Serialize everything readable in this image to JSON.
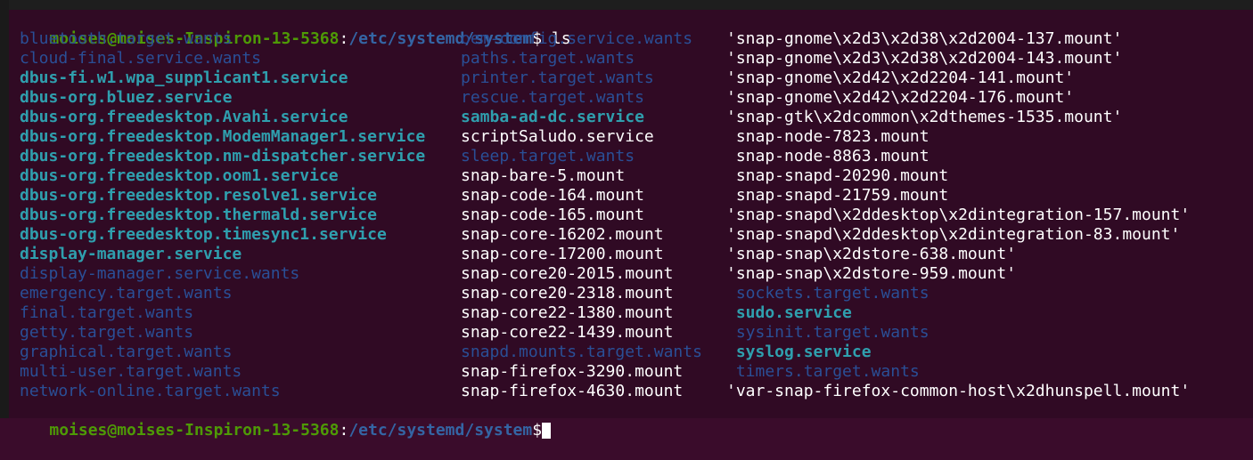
{
  "prompt": {
    "user_host": "moises@moises-Inspiron-13-5368",
    "sep": ":",
    "path": "/etc/systemd/system",
    "symbol": "$",
    "command": " ls"
  },
  "columns": [
    [
      {
        "text": "bluetooth.target.wants",
        "kind": "dir"
      },
      {
        "text": "cloud-final.service.wants",
        "kind": "dir"
      },
      {
        "text": "dbus-fi.w1.wpa_supplicant1.service",
        "kind": "link"
      },
      {
        "text": "dbus-org.bluez.service",
        "kind": "link"
      },
      {
        "text": "dbus-org.freedesktop.Avahi.service",
        "kind": "link"
      },
      {
        "text": "dbus-org.freedesktop.ModemManager1.service",
        "kind": "link"
      },
      {
        "text": "dbus-org.freedesktop.nm-dispatcher.service",
        "kind": "link"
      },
      {
        "text": "dbus-org.freedesktop.oom1.service",
        "kind": "link"
      },
      {
        "text": "dbus-org.freedesktop.resolve1.service",
        "kind": "link"
      },
      {
        "text": "dbus-org.freedesktop.thermald.service",
        "kind": "link"
      },
      {
        "text": "dbus-org.freedesktop.timesync1.service",
        "kind": "link"
      },
      {
        "text": "display-manager.service",
        "kind": "link"
      },
      {
        "text": "display-manager.service.wants",
        "kind": "dir"
      },
      {
        "text": "emergency.target.wants",
        "kind": "dir"
      },
      {
        "text": "final.target.wants",
        "kind": "dir"
      },
      {
        "text": "getty.target.wants",
        "kind": "dir"
      },
      {
        "text": "graphical.target.wants",
        "kind": "dir"
      },
      {
        "text": "multi-user.target.wants",
        "kind": "dir"
      },
      {
        "text": "network-online.target.wants",
        "kind": "dir"
      }
    ],
    [
      {
        "text": "oem-config.service.wants",
        "kind": "dir"
      },
      {
        "text": "paths.target.wants",
        "kind": "dir"
      },
      {
        "text": "printer.target.wants",
        "kind": "dir"
      },
      {
        "text": "rescue.target.wants",
        "kind": "dir"
      },
      {
        "text": "samba-ad-dc.service",
        "kind": "link"
      },
      {
        "text": "scriptSaludo.service",
        "kind": "normal"
      },
      {
        "text": "sleep.target.wants",
        "kind": "dir"
      },
      {
        "text": "snap-bare-5.mount",
        "kind": "normal"
      },
      {
        "text": "snap-code-164.mount",
        "kind": "normal"
      },
      {
        "text": "snap-code-165.mount",
        "kind": "normal"
      },
      {
        "text": "snap-core-16202.mount",
        "kind": "normal"
      },
      {
        "text": "snap-core-17200.mount",
        "kind": "normal"
      },
      {
        "text": "snap-core20-2015.mount",
        "kind": "normal"
      },
      {
        "text": "snap-core20-2318.mount",
        "kind": "normal"
      },
      {
        "text": "snap-core22-1380.mount",
        "kind": "normal"
      },
      {
        "text": "snap-core22-1439.mount",
        "kind": "normal"
      },
      {
        "text": "snapd.mounts.target.wants",
        "kind": "dir"
      },
      {
        "text": "snap-firefox-3290.mount",
        "kind": "normal"
      },
      {
        "text": "snap-firefox-4630.mount",
        "kind": "normal"
      }
    ],
    [
      {
        "text": "'snap-gnome\\x2d3\\x2d38\\x2d2004-137.mount'",
        "kind": "normal"
      },
      {
        "text": "'snap-gnome\\x2d3\\x2d38\\x2d2004-143.mount'",
        "kind": "normal"
      },
      {
        "text": "'snap-gnome\\x2d42\\x2d2204-141.mount'",
        "kind": "normal"
      },
      {
        "text": "'snap-gnome\\x2d42\\x2d2204-176.mount'",
        "kind": "normal"
      },
      {
        "text": "'snap-gtk\\x2dcommon\\x2dthemes-1535.mount'",
        "kind": "normal"
      },
      {
        "text": " snap-node-7823.mount",
        "kind": "normal"
      },
      {
        "text": " snap-node-8863.mount",
        "kind": "normal"
      },
      {
        "text": " snap-snapd-20290.mount",
        "kind": "normal"
      },
      {
        "text": " snap-snapd-21759.mount",
        "kind": "normal"
      },
      {
        "text": "'snap-snapd\\x2ddesktop\\x2dintegration-157.mount'",
        "kind": "normal"
      },
      {
        "text": "'snap-snapd\\x2ddesktop\\x2dintegration-83.mount'",
        "kind": "normal"
      },
      {
        "text": "'snap-snap\\x2dstore-638.mount'",
        "kind": "normal"
      },
      {
        "text": "'snap-snap\\x2dstore-959.mount'",
        "kind": "normal"
      },
      {
        "text": " sockets.target.wants",
        "kind": "dir"
      },
      {
        "text": " sudo.service",
        "kind": "link"
      },
      {
        "text": " sysinit.target.wants",
        "kind": "dir"
      },
      {
        "text": " syslog.service",
        "kind": "link"
      },
      {
        "text": " timers.target.wants",
        "kind": "dir"
      },
      {
        "text": "'var-snap-firefox-common-host\\x2dhunspell.mount'",
        "kind": "normal"
      }
    ]
  ],
  "colors": {
    "background": "#300a24",
    "user_host": "#4e9a06",
    "path": "#3465a4",
    "directory": "#2a4f96",
    "symlink": "#2f9fae",
    "text": "#ffffff"
  }
}
